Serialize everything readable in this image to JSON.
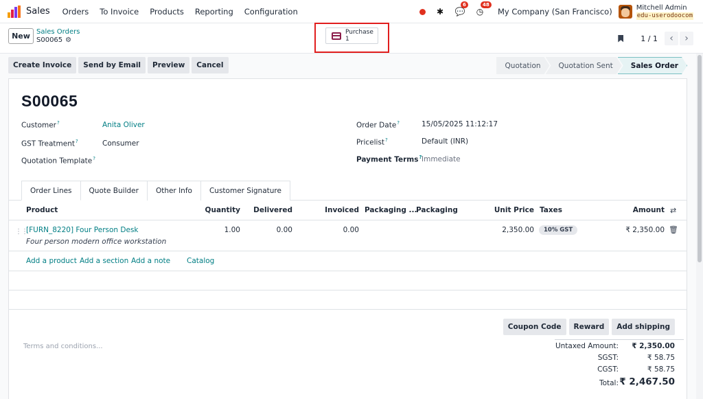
{
  "app": {
    "name": "Sales"
  },
  "menu": [
    "Orders",
    "To Invoice",
    "Products",
    "Reporting",
    "Configuration"
  ],
  "systray": {
    "messages_count": "6",
    "activities_count": "48",
    "company": "My Company (San Francisco)",
    "user_name": "Mitchell Admin",
    "database": "edu-userodoocom"
  },
  "control": {
    "new_label": "New",
    "breadcrumb_parent": "Sales Orders",
    "breadcrumb_current": "S00065",
    "smart_button_label": "Purchase",
    "smart_button_count": "1",
    "pager_value": "1 / 1"
  },
  "actions": [
    "Create Invoice",
    "Send by Email",
    "Preview",
    "Cancel"
  ],
  "stages": [
    {
      "label": "Quotation",
      "active": false
    },
    {
      "label": "Quotation Sent",
      "active": false
    },
    {
      "label": "Sales Order",
      "active": true
    }
  ],
  "form": {
    "title": "S00065",
    "customer_label": "Customer",
    "customer_value": "Anita Oliver",
    "gst_label": "GST Treatment",
    "gst_value": "Consumer",
    "template_label": "Quotation Template",
    "order_date_label": "Order Date",
    "order_date_value": "15/05/2025 11:12:17",
    "pricelist_label": "Pricelist",
    "pricelist_value": "Default (INR)",
    "payment_terms_label": "Payment Terms",
    "payment_terms_value": "Immediate",
    "help_marker": "?"
  },
  "tabs": [
    "Order Lines",
    "Quote Builder",
    "Other Info",
    "Customer Signature"
  ],
  "columns": {
    "product": "Product",
    "quantity": "Quantity",
    "delivered": "Delivered",
    "invoiced": "Invoiced",
    "packaging_qty": "Packaging ...",
    "packaging": "Packaging",
    "unit_price": "Unit Price",
    "taxes": "Taxes",
    "amount": "Amount"
  },
  "lines": [
    {
      "product": "[FURN_8220] Four Person Desk",
      "description": "Four person modern office workstation",
      "quantity": "1.00",
      "delivered": "0.00",
      "invoiced": "0.00",
      "unit_price": "2,350.00",
      "tax": "10% GST",
      "amount": "₹ 2,350.00"
    }
  ],
  "add_links": [
    "Add a product",
    "Add a section",
    "Add a note",
    "Catalog"
  ],
  "terms_placeholder": "Terms and conditions...",
  "footer_buttons": [
    "Coupon Code",
    "Reward",
    "Add shipping"
  ],
  "totals": [
    {
      "label": "Untaxed Amount:",
      "value": "₹ 2,350.00"
    },
    {
      "label": "SGST:",
      "value": "₹ 58.75"
    },
    {
      "label": "CGST:",
      "value": "₹ 58.75"
    },
    {
      "label": "Total:",
      "value": "₹ 2,467.50"
    }
  ],
  "colors": {
    "accent": "#017e84",
    "brand_purple": "#71639e",
    "highlight": "#e11d1d"
  }
}
